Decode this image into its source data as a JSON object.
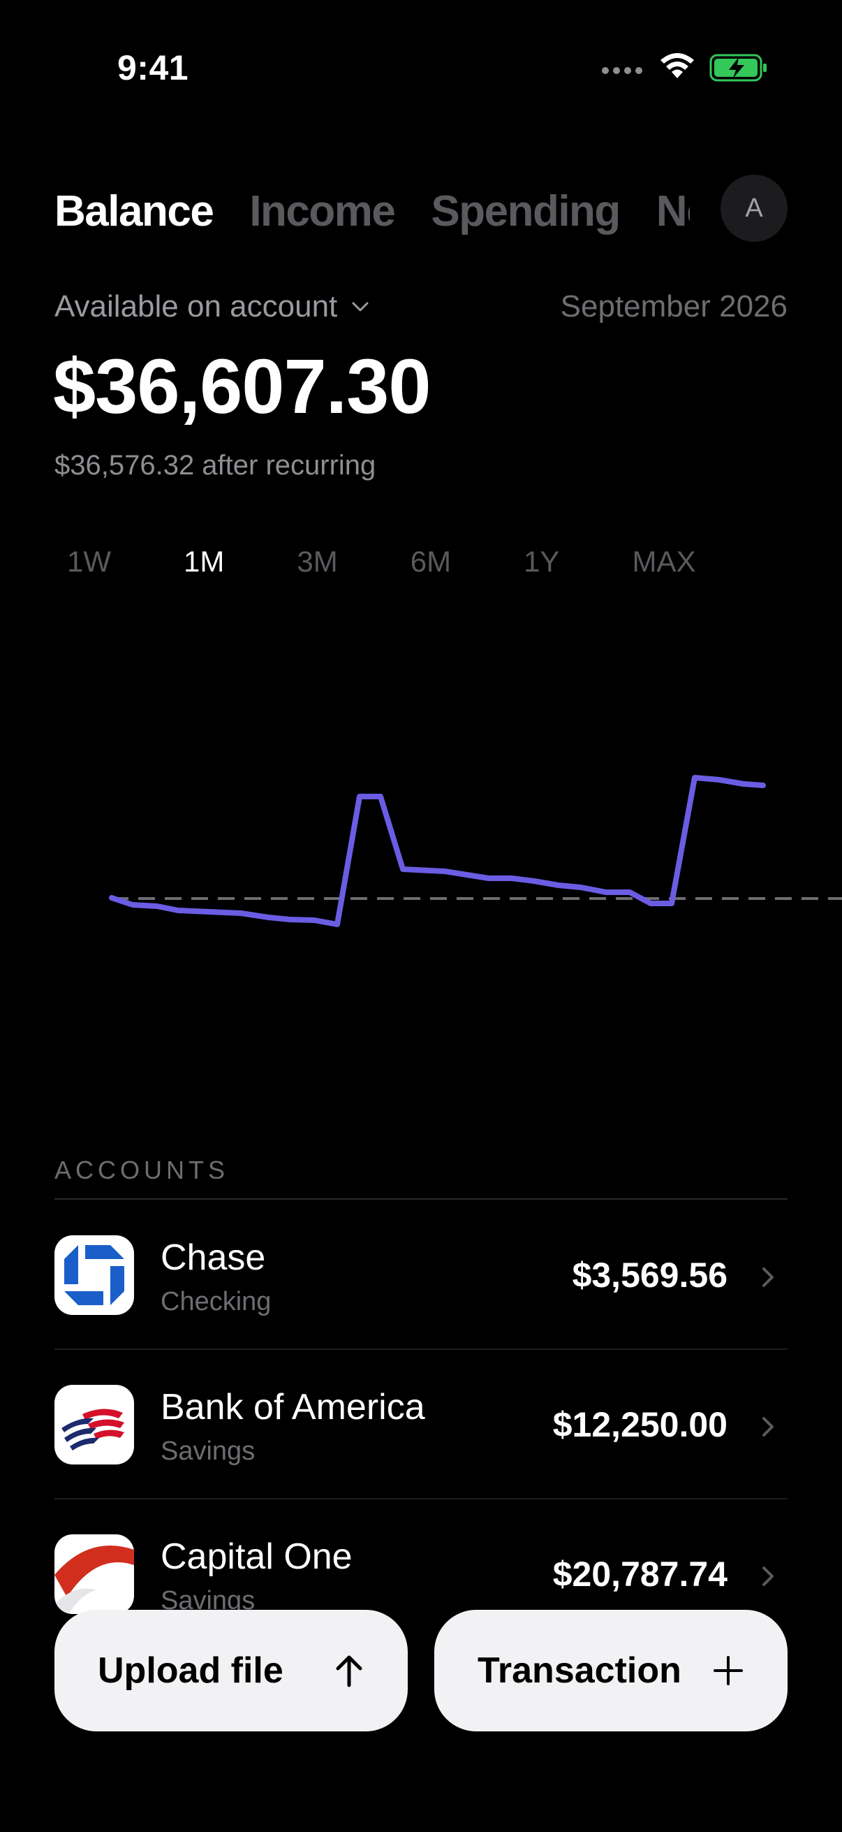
{
  "status_bar": {
    "time": "9:41"
  },
  "tabs": [
    {
      "label": "Balance",
      "active": true
    },
    {
      "label": "Income",
      "active": false
    },
    {
      "label": "Spending",
      "active": false
    },
    {
      "label": "Net worth",
      "active": false
    }
  ],
  "avatar": {
    "initial": "A"
  },
  "balance": {
    "label": "Available on account",
    "period": "September 2026",
    "amount": "$36,607.30",
    "after_recurring": "$36,576.32 after recurring"
  },
  "ranges": [
    {
      "label": "1W",
      "active": false
    },
    {
      "label": "1M",
      "active": true
    },
    {
      "label": "3M",
      "active": false
    },
    {
      "label": "6M",
      "active": false
    },
    {
      "label": "1Y",
      "active": false
    },
    {
      "label": "MAX",
      "active": false
    }
  ],
  "chart": {
    "line_color": "#6b5de3",
    "baseline_color": "#6d6d72"
  },
  "accounts": {
    "header": "ACCOUNTS",
    "items": [
      {
        "name": "Chase",
        "type": "Checking",
        "balance": "$3,569.56",
        "icon": "chase-logo"
      },
      {
        "name": "Bank of America",
        "type": "Savings",
        "balance": "$12,250.00",
        "icon": "bank-of-america-logo"
      },
      {
        "name": "Capital One",
        "type": "Savings",
        "balance": "$20,787.74",
        "icon": "capital-one-logo"
      }
    ]
  },
  "actions": {
    "upload_label": "Upload file",
    "transaction_label": "Transaction"
  }
}
